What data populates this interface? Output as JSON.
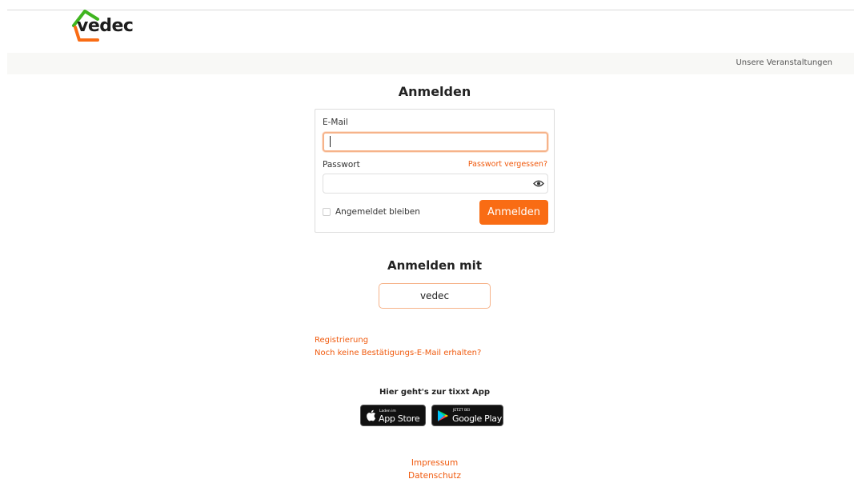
{
  "brand": {
    "name": "vedec",
    "colors": {
      "green": "#3fb51f",
      "orange": "#f96c14"
    }
  },
  "nav": {
    "events_link": "Unsere Veranstaltungen"
  },
  "login": {
    "title": "Anmelden",
    "email_label": "E-Mail",
    "email_value": "",
    "password_label": "Passwort",
    "password_value": "",
    "forgot_link": "Passwort vergessen?",
    "remember_label": "Angemeldet bleiben",
    "remember_checked": false,
    "submit_label": "Anmelden"
  },
  "sso": {
    "title": "Anmelden mit",
    "provider_label": "vedec"
  },
  "links": {
    "register": "Registrierung",
    "no_confirmation": "Noch keine Bestätigungs-E-Mail erhalten?"
  },
  "app": {
    "heading": "Hier geht's zur tixxt App",
    "appstore": {
      "small": "Laden im",
      "big": "App Store",
      "icon": "apple-icon"
    },
    "googleplay": {
      "small": "JETZT BEI",
      "big": "Google Play",
      "icon": "google-play-icon"
    }
  },
  "footer": {
    "impressum": "Impressum",
    "datenschutz": "Datenschutz"
  }
}
